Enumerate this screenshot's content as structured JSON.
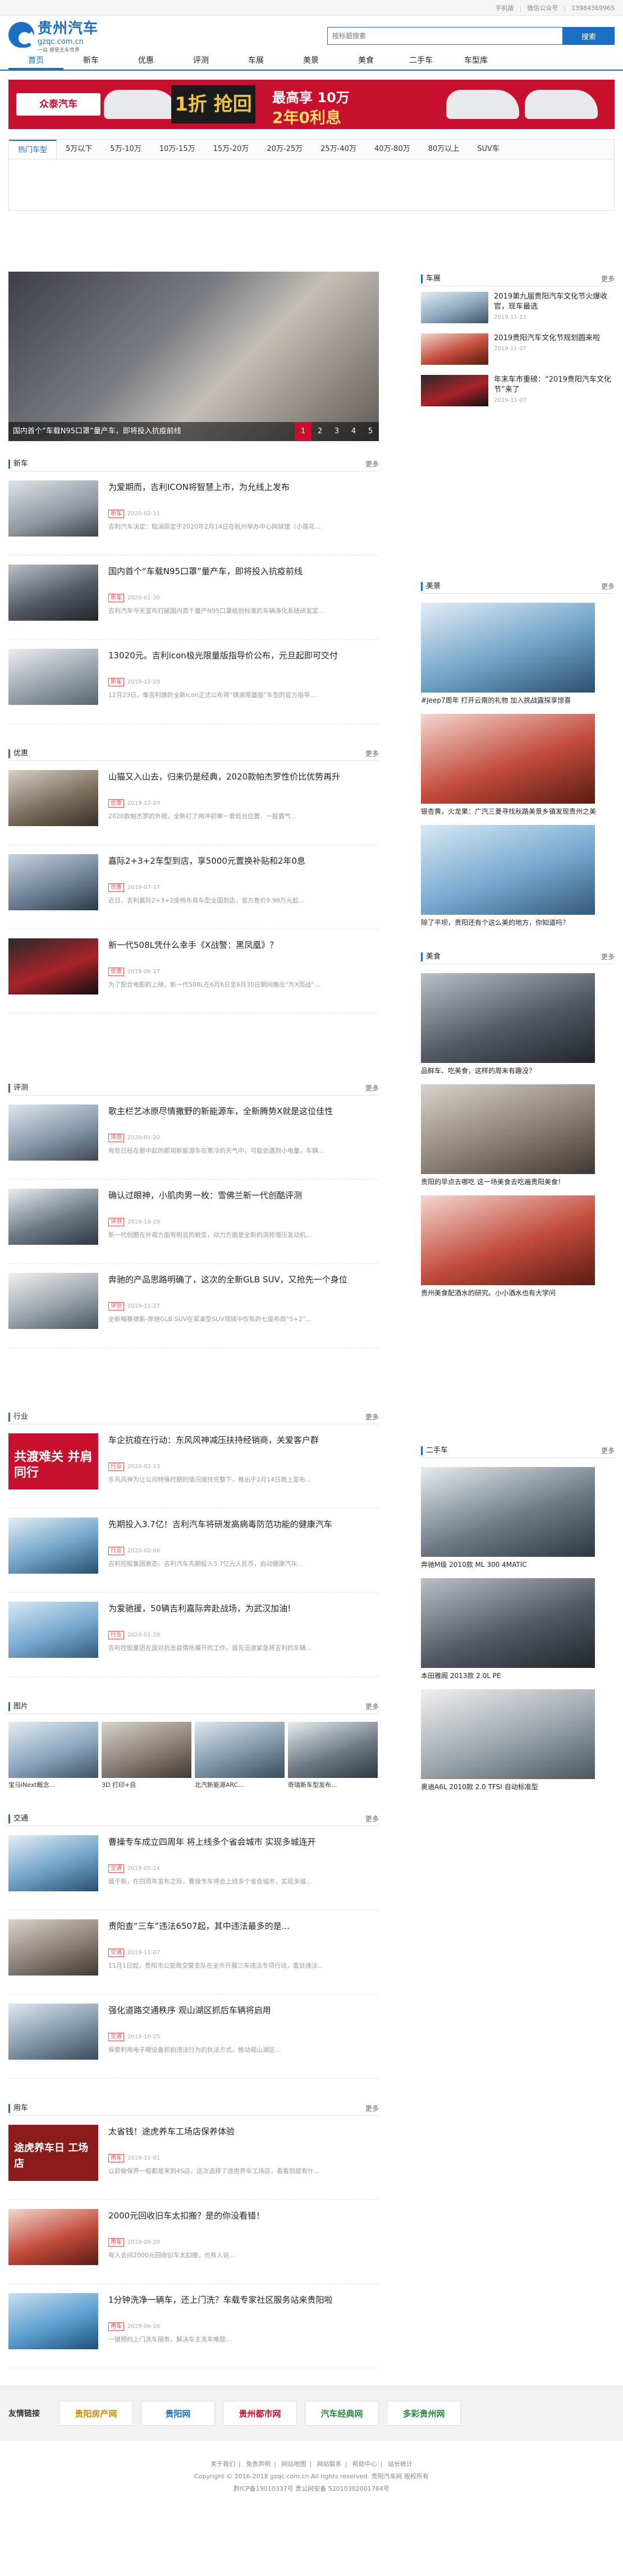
{
  "topbar": {
    "mobile": "手机版",
    "wechat": "微信公众号",
    "phone": "13984369965"
  },
  "logo": {
    "name": "贵州汽车",
    "domain": "gzqc.com.cn",
    "slogan": "一站 感受无车世界"
  },
  "search": {
    "placeholder": "按标题搜索",
    "button": "搜索"
  },
  "nav": [
    "首页",
    "新车",
    "优惠",
    "评测",
    "车展",
    "美景",
    "美食",
    "二手车",
    "车型库"
  ],
  "banner": {
    "brand": "众泰汽车",
    "block": "1折 抢回家",
    "line1": "最高享 10万",
    "line2": "2年0利息"
  },
  "price_tabs": [
    "热门车型",
    "5万以下",
    "5万-10万",
    "10万-15万",
    "15万-20万",
    "20万-25万",
    "25万-40万",
    "40万-80万",
    "80万以上",
    "SUV车"
  ],
  "slider": {
    "caption": "国内首个“车载N95口罩”量产车，即将投入抗疫前线",
    "dots": [
      "1",
      "2",
      "3",
      "4",
      "5"
    ]
  },
  "sections": [
    {
      "title": "新车",
      "more": "更多",
      "articles": [
        {
          "title": "为爱期而，吉利ICON将智慧上市，为允线上发布",
          "tag": "新车",
          "date": "2020-02-11",
          "summary": "吉利汽车决定：取消原定于2020年2月14日在杭州举办中心网球馆（小莲花..."
        },
        {
          "title": "国内首个“车载N95口罩”量产车，即将投入抗疫前线",
          "tag": "新车",
          "date": "2020-01-30",
          "summary": "吉利汽车今天宣布打破国内首个量产N95口罩级别标准的车辆净化系统研发定..."
        },
        {
          "title": "13020元。吉利icon极光限量版指导价公布，元旦起即可交付",
          "tag": "新车",
          "date": "2019-12-29",
          "summary": "12月23日，像吉利旗的全新icon正式公布将“铸浪限量版”车型的官方指导..."
        }
      ]
    },
    {
      "title": "优惠",
      "more": "更多",
      "articles": [
        {
          "title": "山猫又入山去，归来仍是经典，2020款帕杰罗性价比优势再升",
          "tag": "优惠",
          "date": "2019-12-29",
          "summary": "2020款帕杰罗的外观，全新打了两冲初审一套低台位置，一股霸气..."
        },
        {
          "title": "嘉际2+3+2车型到店，享5000元置换补贴和2年0息",
          "tag": "优惠",
          "date": "2019-07-17",
          "summary": "近日，吉利嘉际2+3+2座椅布局车型全国到店，官方售价9.98万元起..."
        },
        {
          "title": "新一代508L凭什么幸手《X战警：黑凤凰》？",
          "tag": "优惠",
          "date": "2019-06-17",
          "summary": "为了配合电影的上映，新一代508L在6月6日至6月30日期间推出“为X而战”..."
        }
      ]
    },
    {
      "title": "评测",
      "more": "更多",
      "articles": [
        {
          "title": "歌主栏艺冰原尽情撒野的新能源车，全新腾势X就是这位佳性",
          "tag": "评测",
          "date": "2020-01-20",
          "summary": "有些已经在那中起的那用新能源车在寒冷的天气中，可能会遇到小电量，车辆..."
        },
        {
          "title": "确认过眼神，小肌肉男一枚：雪佛兰新一代创酷评测",
          "tag": "评测",
          "date": "2019-10-29",
          "summary": "新一代创酷在外观方面有明显的蜕变，动力方面是全新的涡轮增压发动机..."
        },
        {
          "title": "奔驰的产品思路明确了，这次的全新GLB SUV，又抢先一个身位",
          "tag": "评测",
          "date": "2019-11-27",
          "summary": "全新梅赛德斯-奔驰GLB SUV在紧凑型SUV领域中仅有的七座布局“5+2”..."
        }
      ]
    },
    {
      "title": "行业",
      "more": "更多",
      "articles": [
        {
          "title": "车企抗疫在行动：东风风神减压扶持经销商，关爱客户群",
          "tag": "行业",
          "date": "2020-02-13",
          "summary": "东风风神为让公司特殊时期的情况维持完整下，推出于2月14日晚上宣布...",
          "thumb_text": "共渡难关 并肩同行"
        },
        {
          "title": "先期投入3.7亿！吉利汽车将研发高病毒防范功能的健康汽车",
          "tag": "行业",
          "date": "2020-02-06",
          "summary": "吉利控股集团表态，吉利汽车先期投入3.7亿元人民币，启动健康汽车…"
        },
        {
          "title": "为爱驰援，50辆吉利嘉际奔赴战场，为武汉加油!",
          "tag": "行业",
          "date": "2020-01-28",
          "summary": "吉利控股集团在面对抗击疫情所展开的工作，首先迅速紧急将吉利的车辆..."
        }
      ]
    }
  ],
  "pictures": {
    "title": "图片",
    "more": "更多",
    "items": [
      "宝马iNext概念...",
      "3D 打印+自",
      "北汽新能源ARC...",
      "奇瑞新车型发布..."
    ]
  },
  "sections2": [
    {
      "title": "交通",
      "more": "更多",
      "articles": [
        {
          "title": "曹操专车成立四周年 将上线多个省会城市 实现多城连开",
          "tag": "交通",
          "date": "2019-05-24",
          "summary": "属于新，在四周年发布之际，曹操专车将会上线多个省会城市，实现多城..."
        },
        {
          "title": "贵阳查“三车”违法6507起，其中违法最多的是...",
          "tag": "交通",
          "date": "2019-11-07",
          "summary": "11月1日起，贵阳市公安局交警支队在全市开展三车违法专项行动，查处违法..."
        },
        {
          "title": "强化道路交通秩序 观山湖区抓后车辆将启用",
          "tag": "交通",
          "date": "2019-10-25",
          "summary": "探索利用电子眼设备抓拍违法行为的执法方式，推动观山湖区..."
        }
      ]
    },
    {
      "title": "用车",
      "more": "更多",
      "articles": [
        {
          "title": "太省钱！途虎养车工场店保养体验",
          "tag": "用车",
          "date": "2019-11-01",
          "summary": "以前做保养一般都是来到4S店，这次选择了途虎养车工场店，看看到底有什...",
          "thumb_text": "途虎养车日 工场店"
        },
        {
          "title": "2000元回收旧车太扣搬？是的你没看错！",
          "tag": "用车",
          "date": "2019-09-29",
          "summary": "有人会问2000元回收旧车太扣搬，也有人说..."
        },
        {
          "title": "1分钟洗净一辆车，还上门洗？车载专家社区服务站来贵阳啦",
          "tag": "用车",
          "date": "2019-06-26",
          "summary": "一键预约上门洗车服务，解决车主洗车难题..."
        }
      ]
    }
  ],
  "side": {
    "chezhan": {
      "title": "车展",
      "more": "更多",
      "items": [
        {
          "title": "2019第九届贵阳汽车文化节火爆收官，现车最选",
          "date": "2019-11-11"
        },
        {
          "title": "2019贵阳汽车文化节规划圆来啦",
          "date": "2019-11-07"
        },
        {
          "title": "年末车市重磅：“2019贵阳汽车文化节”来了",
          "date": "2019-11-07"
        }
      ]
    },
    "meijing": {
      "title": "美景",
      "more": "更多",
      "items": [
        "#Jeep7周年 打开云南的礼物 加入挑战露探享惊喜",
        "银杏黄，火龙果：广汽三菱寻找秋路美景乡镇发现贵州之美",
        "除了平坝，贵阳还有个这么美的地方，你知道吗？"
      ]
    },
    "meishi": {
      "title": "美食",
      "more": "更多",
      "items": [
        "品鲜车、吃美食，这样的周末有趣没？",
        "贵阳的早点去哪吃 这一场美食去吃遍贵阳美食！",
        "贵州美食配酒水的研究。小小酒水也有大学问"
      ]
    },
    "ershou": {
      "title": "二手车",
      "more": "更多",
      "items": [
        "奔驰M级 2010款 ML 300 4MATIC",
        "本田雅阁 2013款 2.0L PE",
        "奥迪A6L 2010款 2.0 TFSI 自动标准型"
      ]
    }
  },
  "friend": {
    "label": "友情链接",
    "links": [
      "贵阳房产网",
      "贵阳网",
      "贵州都市网",
      "汽车经典网",
      "多彩贵州网"
    ]
  },
  "footer": {
    "links": [
      "关于我们",
      "免责声明",
      "网站地图",
      "网站联系",
      "帮助中心",
      "站长统计"
    ],
    "copyright": "Copyright © 2016-2018 gzqc.com.cn All rights reserved.  贵阳汽车网 版权所有",
    "icp": "黔ICP备19010337号",
    "police": "贵公网安备 52010302001784号"
  },
  "colors": {
    "brand": "#1a6fc4",
    "accent": "#c8102e"
  }
}
